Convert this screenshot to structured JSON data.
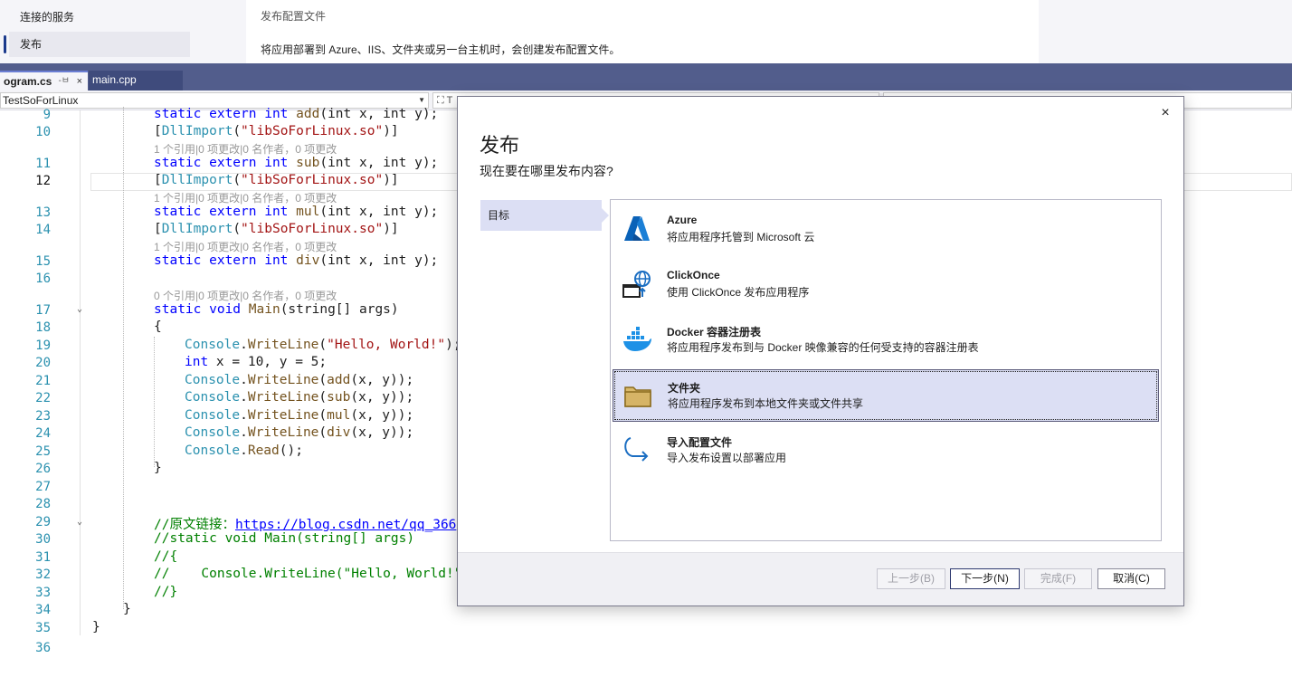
{
  "settings_panel": {
    "nav_items": [
      "连接的服务",
      "发布"
    ],
    "title": "发布配置文件",
    "description": "将应用部署到 Azure、IIS、文件夹或另一台主机时，会创建发布配置文件。"
  },
  "tabs": {
    "active": {
      "label": "ogram.cs",
      "pin": "-ㅂ",
      "close": "×"
    },
    "second": {
      "label": "main.cpp"
    }
  },
  "navbar": {
    "project": "TestSoForLinux",
    "member_partial": "T"
  },
  "editor": {
    "line_numbers": [
      "9",
      "10",
      "11",
      "12",
      "13",
      "14",
      "15",
      "16",
      "17",
      "18",
      "19",
      "20",
      "21",
      "22",
      "23",
      "24",
      "25",
      "26",
      "27",
      "28",
      "29",
      "30",
      "31",
      "32",
      "33",
      "34",
      "35",
      "36"
    ],
    "lens_ref1": "1 个引用|0 项更改|0 名作者，0 项更改",
    "lens_ref0": "0 个引用|0 项更改|0 名作者，0 项更改",
    "lines": {
      "l9": {
        "kw": "static extern int ",
        "fn": "add",
        "rest": "(int x, int y);"
      },
      "l10": {
        "a": "[",
        "cls": "DllImport",
        "b": "(",
        "str": "\"libSoForLinux.so\"",
        "c": ")]"
      },
      "l11": {
        "kw": "static extern int ",
        "fn": "sub",
        "rest": "(int x, int y);"
      },
      "l12": {
        "a": "[",
        "cls": "DllImport",
        "b": "(",
        "str": "\"libSoForLinux.so\"",
        "c": ")]"
      },
      "l13": {
        "kw": "static extern int ",
        "fn": "mul",
        "rest": "(int x, int y);"
      },
      "l14": {
        "a": "[",
        "cls": "DllImport",
        "b": "(",
        "str": "\"libSoForLinux.so\"",
        "c": ")]"
      },
      "l15": {
        "kw": "static extern int ",
        "fn": "div",
        "rest": "(int x, int y);"
      },
      "l17": {
        "kw": "static void ",
        "fn": "Main",
        "rest": "(string[] args)"
      },
      "l18": "{",
      "l19": {
        "cls": "Console",
        "a": ".",
        "fn": "WriteLine",
        "b": "(",
        "str": "\"Hello, World!\"",
        "c": ");"
      },
      "l20": {
        "kw": "int ",
        "rest": "x = 10, y = 5;"
      },
      "l21": {
        "cls": "Console",
        "a": ".",
        "fn": "WriteLine",
        "b": "(",
        "fn2": "add",
        "c": "(x, y));"
      },
      "l22": {
        "cls": "Console",
        "a": ".",
        "fn": "WriteLine",
        "b": "(",
        "fn2": "sub",
        "c": "(x, y));"
      },
      "l23": {
        "cls": "Console",
        "a": ".",
        "fn": "WriteLine",
        "b": "(",
        "fn2": "mul",
        "c": "(x, y));"
      },
      "l24": {
        "cls": "Console",
        "a": ".",
        "fn": "WriteLine",
        "b": "(",
        "fn2": "div",
        "c": "(x, y));"
      },
      "l25": {
        "cls": "Console",
        "a": ".",
        "fn": "Read",
        "c": "();"
      },
      "l26": "}",
      "l29": {
        "cmt": "//原文链接：",
        "link": "https://blog.csdn.net/qq_366"
      },
      "l30": "//static void Main(string[] args)",
      "l31": "//{",
      "l32": "//    Console.WriteLine(\"Hello, World!\"",
      "l33": "//}",
      "l34": "}",
      "l35": "}"
    }
  },
  "dialog": {
    "close": "×",
    "title": "发布",
    "subtitle": "现在要在哪里发布内容?",
    "step": "目标",
    "targets": [
      {
        "name": "Azure",
        "desc": "将应用程序托管到 Microsoft 云",
        "icon": "azure-icon"
      },
      {
        "name": "ClickOnce",
        "desc": "使用 ClickOnce 发布应用程序",
        "icon": "clickonce-icon"
      },
      {
        "name": "Docker 容器注册表",
        "desc": "将应用程序发布到与 Docker 映像兼容的任何受支持的容器注册表",
        "icon": "docker-icon"
      },
      {
        "name": "文件夹",
        "desc": "将应用程序发布到本地文件夹或文件共享",
        "icon": "folder-icon"
      },
      {
        "name": "导入配置文件",
        "desc": "导入发布设置以部署应用",
        "icon": "import-arrow-icon"
      }
    ],
    "buttons": {
      "prev": "上一步(B)",
      "next": "下一步(N)",
      "finish": "完成(F)",
      "cancel": "取消(C)"
    }
  },
  "colors": {
    "accent": "#525d8c",
    "selection": "#dcdff4"
  }
}
